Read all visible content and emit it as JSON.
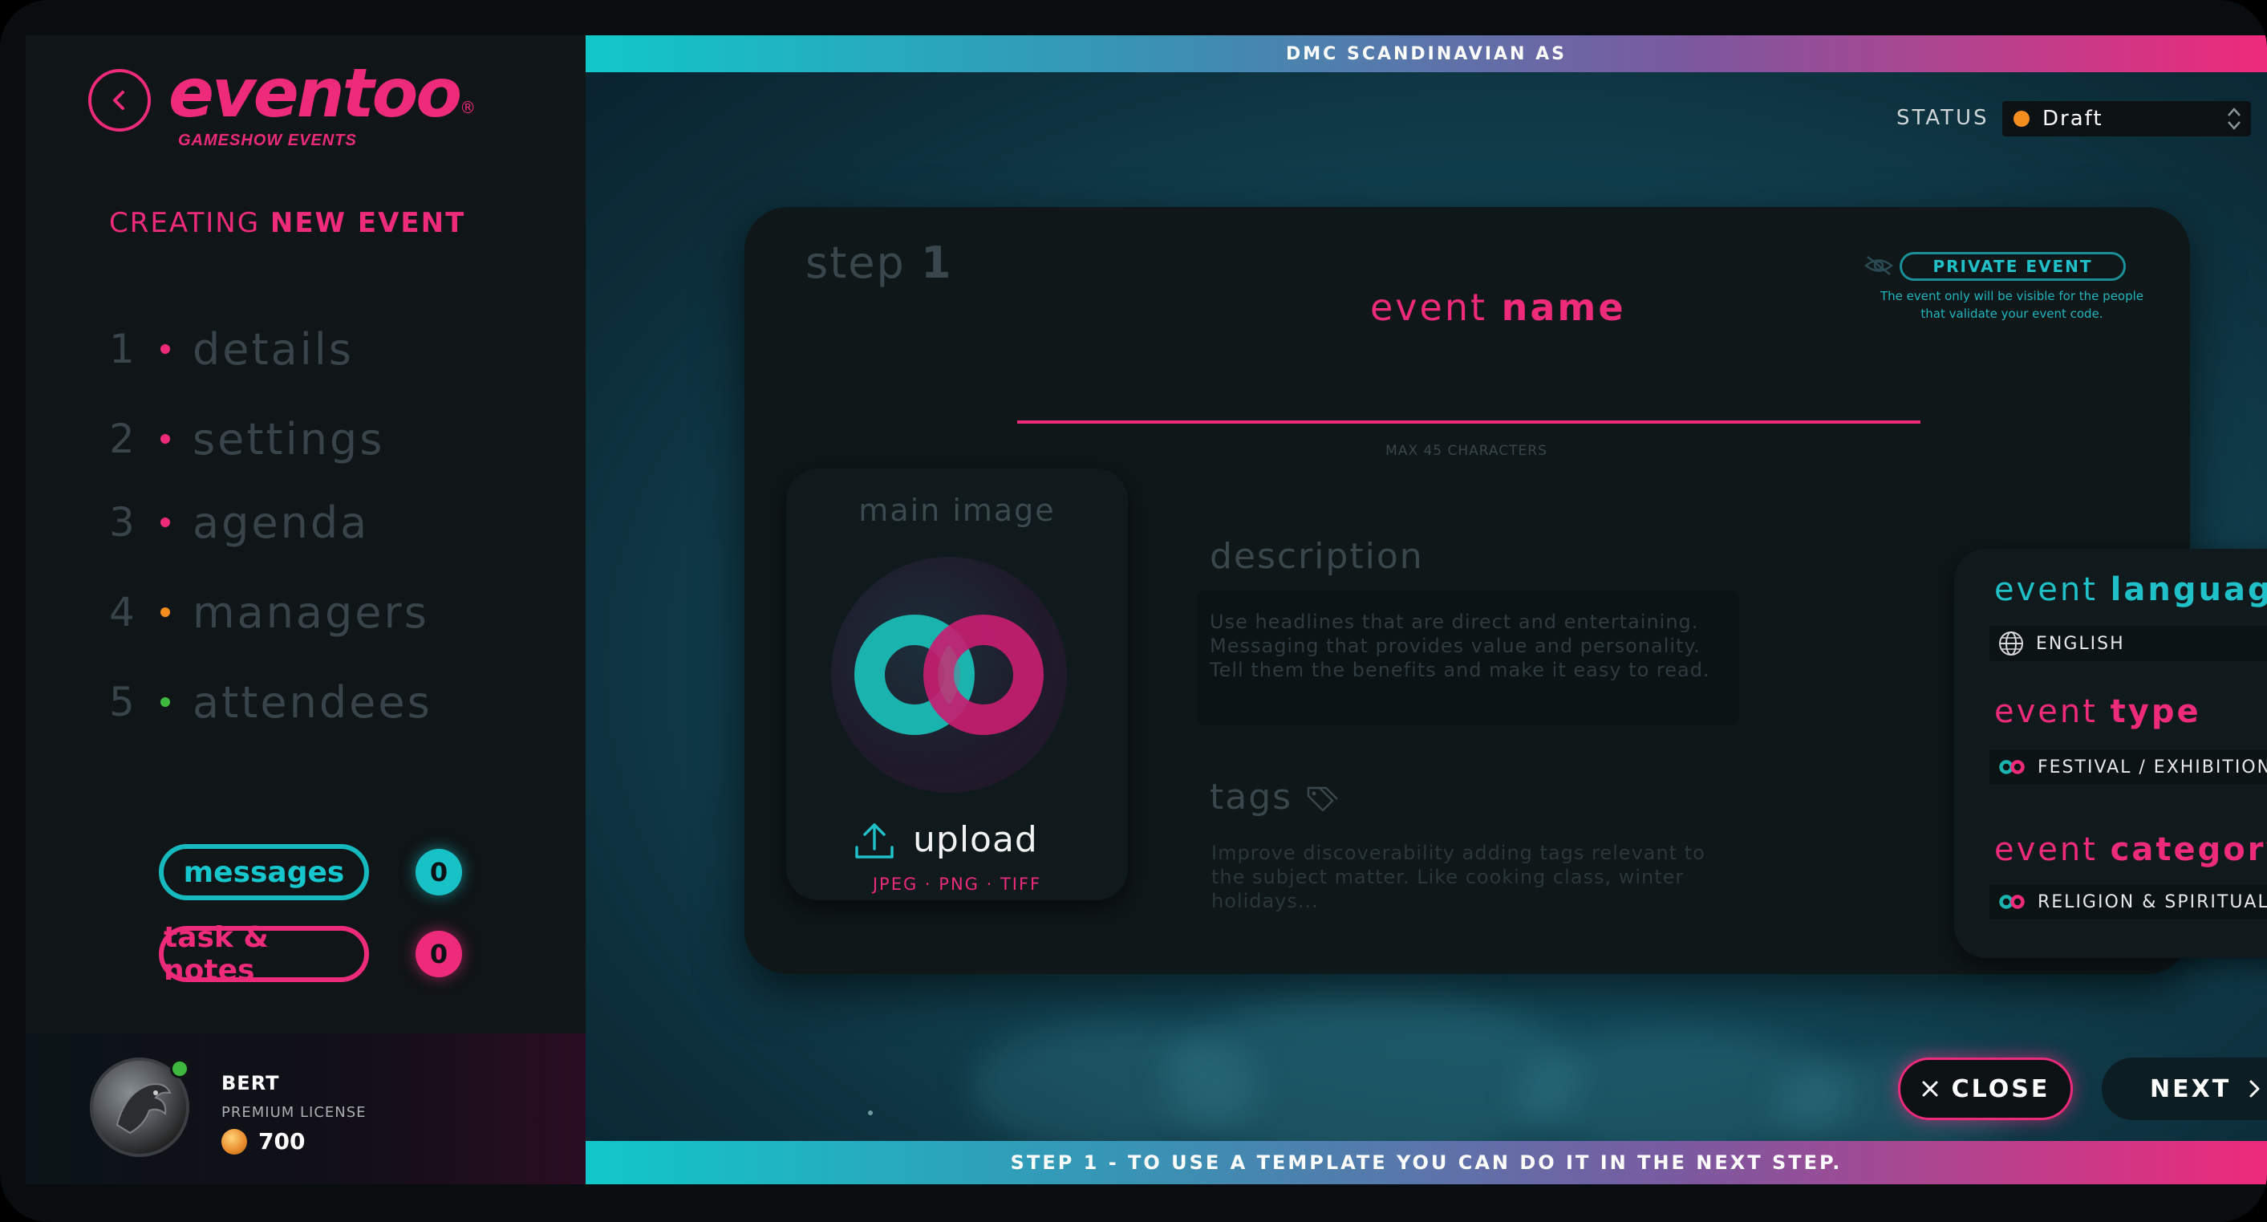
{
  "app": {
    "logo_text": "eventoo",
    "logo_reg": "®",
    "logo_subtitle": "GAMESHOW EVENTS"
  },
  "sidebar": {
    "heading_thin": "CREATING",
    "heading_bold": "NEW EVENT",
    "steps": [
      {
        "num": "1",
        "label": "details",
        "dot_color": "#ee2a7b"
      },
      {
        "num": "2",
        "label": "settings",
        "dot_color": "#ee2a7b"
      },
      {
        "num": "3",
        "label": "agenda",
        "dot_color": "#ee2a7b"
      },
      {
        "num": "4",
        "label": "managers",
        "dot_color": "#f28d1e"
      },
      {
        "num": "5",
        "label": "attendees",
        "dot_color": "#3fb83f"
      }
    ],
    "messages_label": "messages",
    "messages_count": "0",
    "tasks_label": "task & notes",
    "tasks_count": "0"
  },
  "user": {
    "name": "BERT",
    "license": "PREMIUM LICENSE",
    "coins": "700",
    "online": true
  },
  "header": {
    "company": "DMC SCANDINAVIAN AS",
    "status_label": "STATUS",
    "status_value": "Draft",
    "status_color": "#f28d1e"
  },
  "form": {
    "step_prefix": "step",
    "step_number": "1",
    "event_name_thin": "event",
    "event_name_bold": "name",
    "event_name_value": "",
    "max_chars": "MAX 45 CHARACTERS",
    "private_label": "PRIVATE EVENT",
    "private_note": "The event only will be visible for the people that validate your event code.",
    "main_image_title": "main image",
    "upload_label": "upload",
    "upload_formats": "JPEG · PNG · TIFF",
    "description_title": "description",
    "description_placeholder": "Use headlines that are direct and entertaining. Messaging that provides value and personality. Tell them the benefits and make it easy to read.",
    "tags_title": "tags",
    "tags_placeholder": "Improve discoverability adding tags relevant to the subject matter. Like cooking class, winter holidays..."
  },
  "side": {
    "language_thin": "event",
    "language_bold": "language",
    "language_value": "ENGLISH",
    "type_thin": "event",
    "type_bold": "type",
    "type_value": "FESTIVAL / EXHIBITION",
    "category_thin": "event",
    "category_bold": "category",
    "category_value": "RELIGION & SPIRITUALITY"
  },
  "actions": {
    "close_label": "CLOSE",
    "next_label": "NEXT"
  },
  "footer": {
    "hint": "STEP 1 - TO USE A TEMPLATE YOU CAN DO IT IN THE NEXT STEP."
  },
  "colors": {
    "accent_pink": "#ee2a7b",
    "accent_cyan": "#15c6cc"
  }
}
